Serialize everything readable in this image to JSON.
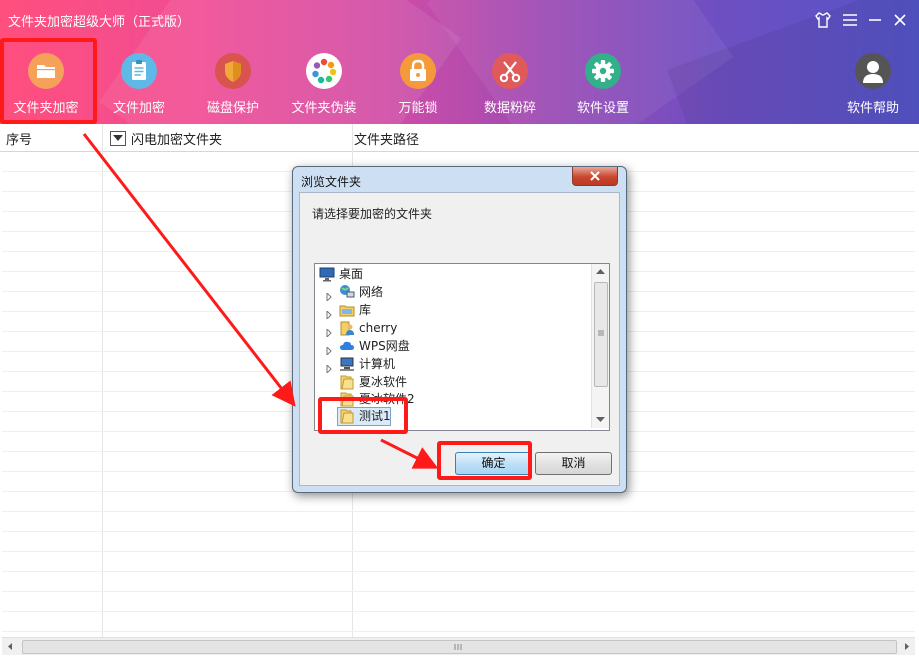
{
  "app": {
    "title": "文件夹加密超级大师（正式版）",
    "window_buttons": [
      "shirt-icon",
      "menu-icon",
      "minimize-icon",
      "close-icon"
    ]
  },
  "toolbar": {
    "items": [
      {
        "label": "文件夹加密",
        "icon": "folder-icon",
        "color": "#f6a15a"
      },
      {
        "label": "文件加密",
        "icon": "clipboard-icon",
        "color": "#5fb9e6"
      },
      {
        "label": "磁盘保护",
        "icon": "shield-icon",
        "color": "#f1a93a"
      },
      {
        "label": "文件夹伪装",
        "icon": "color-wheel-icon",
        "color": "#ffffff"
      },
      {
        "label": "万能锁",
        "icon": "lock-icon",
        "color": "#f59a3a"
      },
      {
        "label": "数据粉碎",
        "icon": "scissors-icon",
        "color": "#e05a5a"
      },
      {
        "label": "软件设置",
        "icon": "gear-icon",
        "color": "#31b089"
      },
      {
        "label": "软件帮助",
        "icon": "user-icon",
        "color": "#555555"
      }
    ]
  },
  "table": {
    "headers": [
      "序号",
      "闪电加密文件夹",
      "文件夹路径"
    ]
  },
  "dialog": {
    "title": "浏览文件夹",
    "prompt": "请选择要加密的文件夹",
    "tree": [
      {
        "label": "桌面",
        "icon": "desktop-icon"
      },
      {
        "label": "网络",
        "icon": "network-icon"
      },
      {
        "label": "库",
        "icon": "library-icon"
      },
      {
        "label": "cherry",
        "icon": "user-folder-icon"
      },
      {
        "label": "WPS网盘",
        "icon": "cloud-icon"
      },
      {
        "label": "计算机",
        "icon": "computer-icon"
      },
      {
        "label": "夏冰软件",
        "icon": "folder-icon"
      },
      {
        "label": "夏冰软件2",
        "icon": "folder-icon"
      },
      {
        "label": "测试1",
        "icon": "folder-icon",
        "selected": true
      }
    ],
    "ok": "确定",
    "cancel": "取消"
  },
  "colors": {
    "highlight": "#ff1a1a",
    "header_gradient_start": "#ff4f7e",
    "header_gradient_end": "#5454c7"
  }
}
